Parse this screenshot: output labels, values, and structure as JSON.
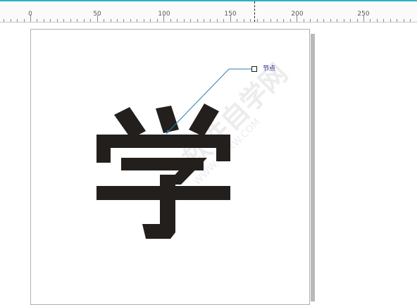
{
  "ruler": {
    "labels": [
      "0",
      "50",
      "100",
      "150",
      "200",
      "250"
    ]
  },
  "node": {
    "label": "节点"
  },
  "glyph": {
    "name": "学",
    "color": "#231f1c"
  },
  "watermark": {
    "text": "软件自学网",
    "subtext": "WWW.RJZXW.COM"
  },
  "colors": {
    "ruler_accent": "#2db0c8",
    "node_line": "#2a7fb0",
    "node_label": "#1a1a8c"
  }
}
